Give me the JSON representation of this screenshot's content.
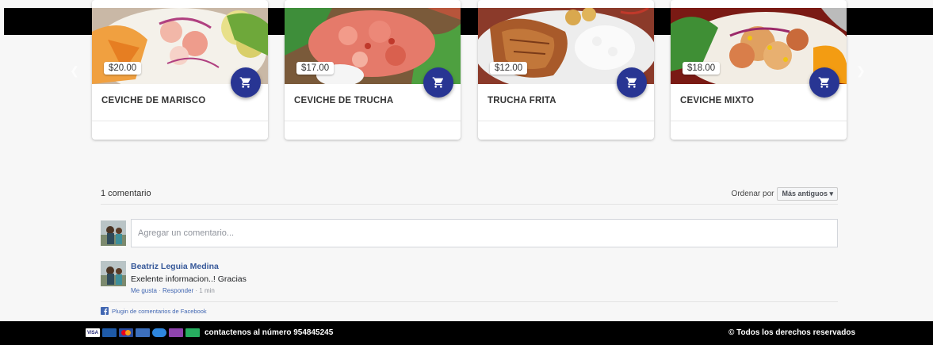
{
  "products": [
    {
      "title": "CEVICHE DE MARISCO",
      "price": "$20.00",
      "icon": "cart-icon"
    },
    {
      "title": "CEVICHE DE TRUCHA",
      "price": "$17.00",
      "icon": "cart-icon"
    },
    {
      "title": "TRUCHA FRITA",
      "price": "$12.00",
      "icon": "cart-icon"
    },
    {
      "title": "CEVICHE MIXTO",
      "price": "$18.00",
      "icon": "cart-icon"
    }
  ],
  "carousel": {
    "prev_icon": "chevron-left-icon",
    "next_icon": "chevron-right-icon"
  },
  "comments": {
    "count_label": "1 comentario",
    "sort_label": "Ordenar por",
    "sort_value": "Más antiguos ▾",
    "input_placeholder": "Agregar un comentario...",
    "items": [
      {
        "author": "Beatriz Leguia Medina",
        "text": "Exelente informacion..! Gracias",
        "like": "Me gusta",
        "reply": "Responder",
        "time": "1 min"
      }
    ],
    "plugin_label": "Plugin de comentarios de Facebook"
  },
  "footer": {
    "contact": "contactenos al número 954845245",
    "rights": "© Todos los derechos reservados",
    "payment_icons": [
      "visa-icon",
      "bank-card-icon",
      "mastercard-icon",
      "amex-icon",
      "card-icon",
      "wallet-icon",
      "cash-icon"
    ]
  },
  "colors": {
    "accent": "#283593",
    "footer_bg": "#000000",
    "link": "#4267b2"
  }
}
